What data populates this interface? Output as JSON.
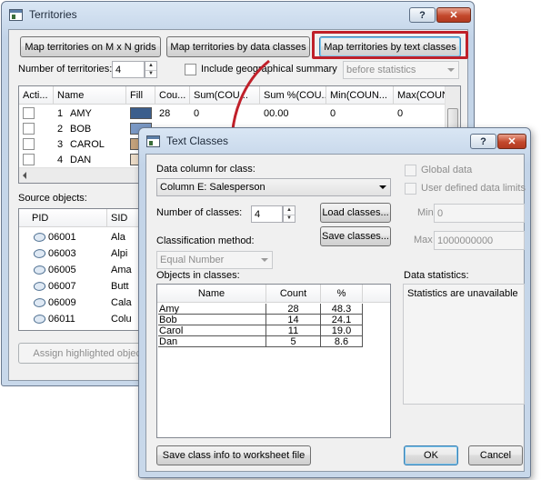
{
  "territories": {
    "title": "Territories",
    "help_glyph": "?",
    "close_glyph": "✕",
    "buttons": {
      "map_grid": "Map territories on M x N grids",
      "map_data": "Map territories by data classes",
      "map_text": "Map territories by text classes",
      "assign": "Assign highlighted objects"
    },
    "num_label": "Number of territories:",
    "num_value": "4",
    "include_label": "Include geographical summary",
    "stat_select": "before statistics",
    "table": {
      "columns": [
        "Acti...",
        "Name",
        "Fill",
        "Cou...",
        "Sum(COU...",
        "Sum %(COU...",
        "Min(COUN...",
        "Max(COUN"
      ],
      "rows": [
        {
          "num": "1",
          "name": "AMY",
          "fill_color": "#3b5e8c",
          "count": "28",
          "sum": "0",
          "sum_pct": "00.00",
          "min": "0",
          "max": "0"
        },
        {
          "num": "2",
          "name": "BOB",
          "fill_color": "#7a98c4",
          "count": "",
          "sum": "",
          "sum_pct": "",
          "min": "",
          "max": ""
        },
        {
          "num": "3",
          "name": "CAROL",
          "fill_color": "#c4a27c",
          "count": "",
          "sum": "",
          "sum_pct": "",
          "min": "",
          "max": ""
        },
        {
          "num": "4",
          "name": "DAN",
          "fill_color": "#ecdcc8",
          "count": "",
          "sum": "",
          "sum_pct": "",
          "min": "",
          "max": ""
        }
      ]
    },
    "source_label": "Source objects:",
    "source": {
      "columns": [
        "PID",
        "SID"
      ],
      "rows": [
        {
          "pid": "06001",
          "sid": "Ala"
        },
        {
          "pid": "06003",
          "sid": "Alpi"
        },
        {
          "pid": "06005",
          "sid": "Ama"
        },
        {
          "pid": "06007",
          "sid": "Butt"
        },
        {
          "pid": "06009",
          "sid": "Cala"
        },
        {
          "pid": "06011",
          "sid": "Colu"
        }
      ]
    }
  },
  "text_classes": {
    "title": "Text Classes",
    "help_glyph": "?",
    "close_glyph": "✕",
    "data_column_label": "Data column for class:",
    "data_column_value": "Column E: Salesperson",
    "num_classes_label": "Number of classes:",
    "num_classes_value": "4",
    "load_button": "Load classes...",
    "save_button": "Save classes...",
    "method_label": "Classification method:",
    "method_value": "Equal Number",
    "objects_label": "Objects in classes:",
    "table": {
      "columns": [
        "Name",
        "Count",
        "%"
      ],
      "rows": [
        {
          "name": "Amy",
          "count": "28",
          "pct": "48.3"
        },
        {
          "name": "Bob",
          "count": "14",
          "pct": "24.1"
        },
        {
          "name": "Carol",
          "count": "11",
          "pct": "19.0"
        },
        {
          "name": "Dan",
          "count": "5",
          "pct": "8.6"
        }
      ]
    },
    "global_data_label": "Global data",
    "user_limits_label": "User defined data limits",
    "min_label": "Min",
    "min_value": "0",
    "max_label": "Max",
    "max_value": "1000000000",
    "stats_label": "Data statistics:",
    "stats_text": "Statistics are unavailable",
    "save_info_button": "Save class info to worksheet file",
    "ok_button": "OK",
    "cancel_button": "Cancel"
  },
  "colors": {
    "highlight_frame": "#c0202a",
    "arrow": "#c0202a",
    "window_frame": "#c8d8ea"
  }
}
